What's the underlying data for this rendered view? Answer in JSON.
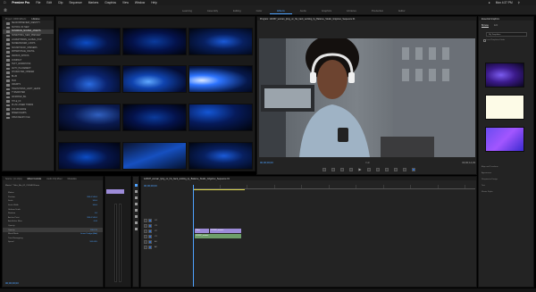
{
  "menubar": {
    "app_name": "Premiere Pro",
    "menus": [
      "File",
      "Edit",
      "Clip",
      "Sequence",
      "Markers",
      "Graphics",
      "View",
      "Window",
      "Help"
    ],
    "clock": "Mon 4:37 PM"
  },
  "workspaces": [
    "Learning",
    "Assembly",
    "Editing",
    "Color",
    "Effects",
    "Audio",
    "Graphics",
    "Libraries",
    "Production",
    "Editor"
  ],
  "workspace_active_index": 4,
  "project_panel": {
    "tabs": [
      "Project: 10000 Effects",
      "Libraries"
    ],
    "active_tab_index": 1,
    "items": [
      "SEASONPREVIEW_IDENTITY",
      "SCHOOL OF NEW",
      "SONDRIVE_MOVIES_ASSETS",
      "SOMETHING_NEW_PREVIEW",
      "LOWERTHIRDS_GLOBAL_POP",
      "SCREENSAVER_LOOPS",
      "SOUNDTRACK_OPENERS",
      "ZIPPERSTAGE_DIGITAL",
      "VERSUS_INTROS",
      "COMPACT",
      "TEXT_ANIMATIONS",
      "AUTO_PLACEMENT",
      "CHARACTER_OPENER",
      "BLUR",
      "HUD",
      "CREDITS",
      "TRANSITIONS_LIGHT_LEAKS",
      "TYPEWRITER",
      "ANIMATED_BG",
      "TITLE_FX",
      "PLUS LOWER THIRDS",
      "COLORGRADE",
      "SPEED RAMPS",
      "OPEN READY FILE"
    ],
    "selected_index": 2
  },
  "program_monitor": {
    "title": "Program: 123337_woman_lying_on_his_back_working_by_Balance_Studio_Grigoriev_Sequence 01",
    "timecode_left": "00;00;00;00",
    "fit_label": "Full",
    "timecode_right": "00;00;14;29"
  },
  "effect_controls": {
    "tabs": [
      "Source: (no clips)",
      "Effect Controls",
      "Audio Clip Mixer",
      "Metadata"
    ],
    "active_tab_index": 1,
    "header": "Master * Titles_Btn_02_CUSHION.mov",
    "rows": [
      {
        "label": "Motion",
        "value": ""
      },
      {
        "label": "Position",
        "value": "960.0  540.0"
      },
      {
        "label": "Scale",
        "value": "100.0"
      },
      {
        "label": "Scale Width",
        "value": "100.0"
      },
      {
        "label": "Uniform Scale",
        "value": ""
      },
      {
        "label": "Rotation",
        "value": "0.0"
      },
      {
        "label": "Anchor Point",
        "value": "960.0  540.0"
      },
      {
        "label": "Anti-flicker Filter",
        "value": "0.00"
      },
      {
        "label": "Opacity",
        "value": ""
      },
      {
        "label": "Opacity",
        "value": "100.0 %"
      },
      {
        "label": "Blend Mode",
        "value": "Linear Dodge (Add)"
      },
      {
        "label": "Time Remapping",
        "value": ""
      },
      {
        "label": "Speed",
        "value": "100.00%"
      }
    ],
    "selected_row_index": 9,
    "timecode": "00;00;00;00"
  },
  "timeline": {
    "title": "123337_woman_lying_on_his_back_working_by_Balance_Studio_Grigoriev_Sequence 01",
    "timecode": "00;00;00;00",
    "tracks": [
      "V4",
      "V3",
      "V2",
      "V1",
      "A1",
      "A2"
    ],
    "clips": [
      {
        "name": "Titles",
        "type": "video"
      },
      {
        "name": "123337_woman",
        "type": "video"
      },
      {
        "name": "123337_woman",
        "type": "audio"
      }
    ]
  },
  "essential_graphics": {
    "title": "Essential Graphics",
    "tabs": [
      "Browse",
      "Edit"
    ],
    "active_tab_index": 0,
    "dropdown": "My Templates",
    "checkbox_label": "Local Templates Folder",
    "side_labels": [
      "Align and Transform",
      "Appearance",
      "Responsive Design",
      "Text",
      "Master Styles"
    ]
  },
  "colors": {
    "accent": "#4ea2ff",
    "panel_bg": "#232323",
    "video_clip": "#9c8bd8",
    "audio_clip": "#6e9f6a"
  }
}
